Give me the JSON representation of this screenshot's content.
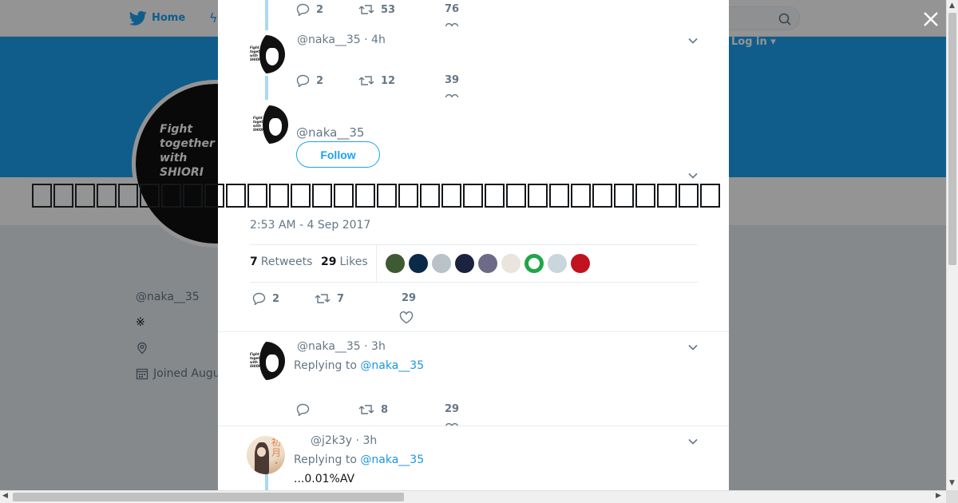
{
  "nav": {
    "home_label": "Home",
    "login_label": "Log in ▾"
  },
  "profile": {
    "avatar_text": [
      "Fight",
      "together",
      "with",
      "SHIORI"
    ],
    "handle": "@naka__35",
    "bio": "※",
    "joined": "Joined Augu"
  },
  "thread": {
    "tweet0": {
      "reply_count": "2",
      "retweet_count": "53",
      "like_count": "76"
    },
    "tweet1": {
      "handle_time": "@naka__35 · 4h",
      "reply_count": "2",
      "retweet_count": "12",
      "like_count": "39"
    },
    "focus": {
      "handle": "@naka__35",
      "follow_label": "Follow",
      "text_glyph": "□",
      "timestamp": "2:53 AM - 4 Sep 2017",
      "retweets_count": "7",
      "retweets_label": "Retweets",
      "likes_count": "29",
      "likes_label": "Likes",
      "likers": [
        "#3e5a32",
        "#0b2a4a",
        "#b9c2c7",
        "#1b2340",
        "#6c6a86",
        "#e9e4dc",
        "#1fa64a",
        "#c9d6dc",
        "#c1121f"
      ],
      "reply_count": "2",
      "retweet_count": "7",
      "like_count": "29"
    },
    "tweet3": {
      "handle_time": "@naka__35 · 3h",
      "replying_label": "Replying to",
      "replying_to": "@naka__35",
      "retweet_count": "8",
      "like_count": "29"
    },
    "tweet4": {
      "handle_time": "@j2k3y · 3h",
      "replying_label": "Replying to",
      "replying_to": "@naka__35",
      "text": "...0.01%AV"
    }
  },
  "colors": {
    "accent": "#1da1f2",
    "link": "#1b95e0",
    "thread_line": "#aad8f3"
  }
}
